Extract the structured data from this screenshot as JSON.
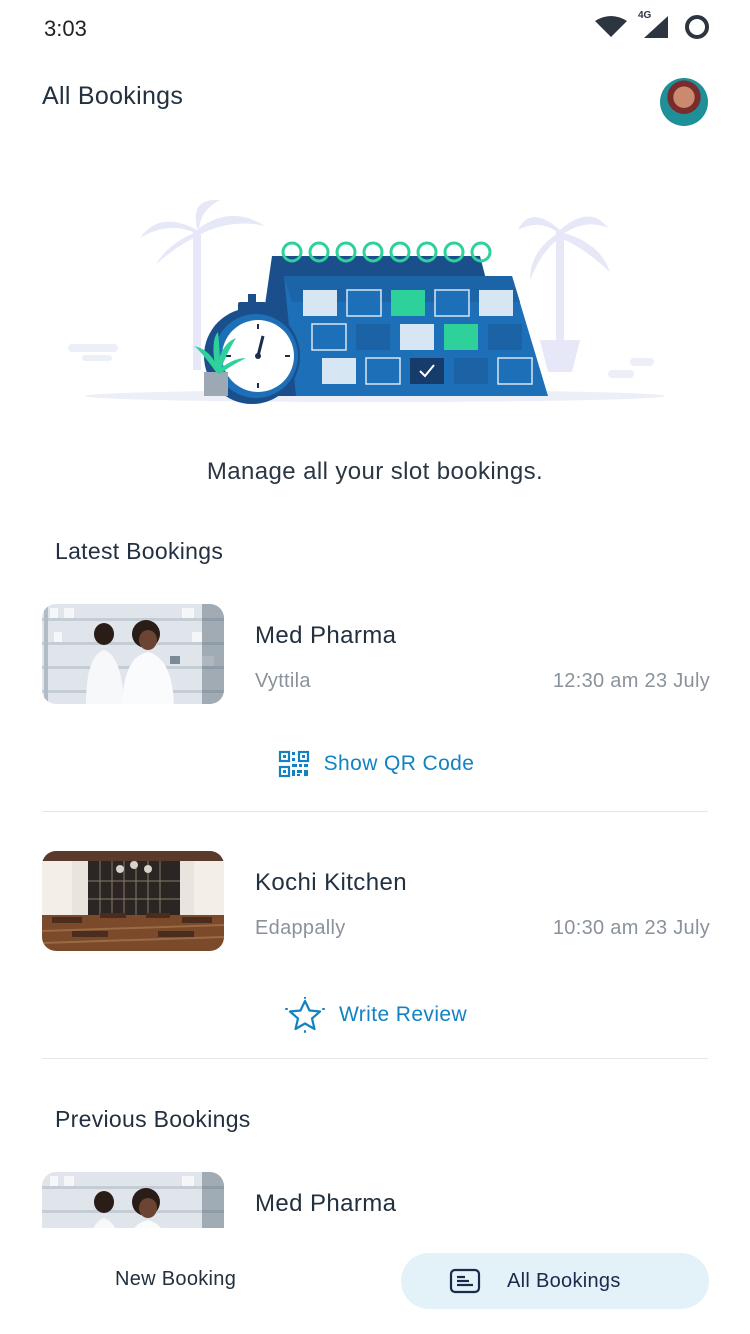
{
  "status": {
    "time": "3:03",
    "network": "4G"
  },
  "header": {
    "title": "All Bookings"
  },
  "hero": {
    "tagline": "Manage all your slot bookings."
  },
  "latest": {
    "title": "Latest Bookings",
    "items": [
      {
        "name": "Med Pharma",
        "location": "Vyttila",
        "time": "12:30 am 23 July",
        "action": "Show QR Code",
        "action_icon": "qr-code-icon"
      },
      {
        "name": "Kochi Kitchen",
        "location": "Edappally",
        "time": "10:30 am 23 July",
        "action": "Write Review",
        "action_icon": "star-icon"
      }
    ]
  },
  "previous": {
    "title": "Previous Bookings",
    "items": [
      {
        "name": "Med Pharma"
      }
    ]
  },
  "nav": {
    "new_label": "New Booking",
    "all_label": "All Bookings"
  },
  "colors": {
    "accent": "#1382c2",
    "nav_active_bg": "#e3f1f8",
    "calendar_blue": "#1d6fb8",
    "calendar_green": "#2ed19a"
  }
}
